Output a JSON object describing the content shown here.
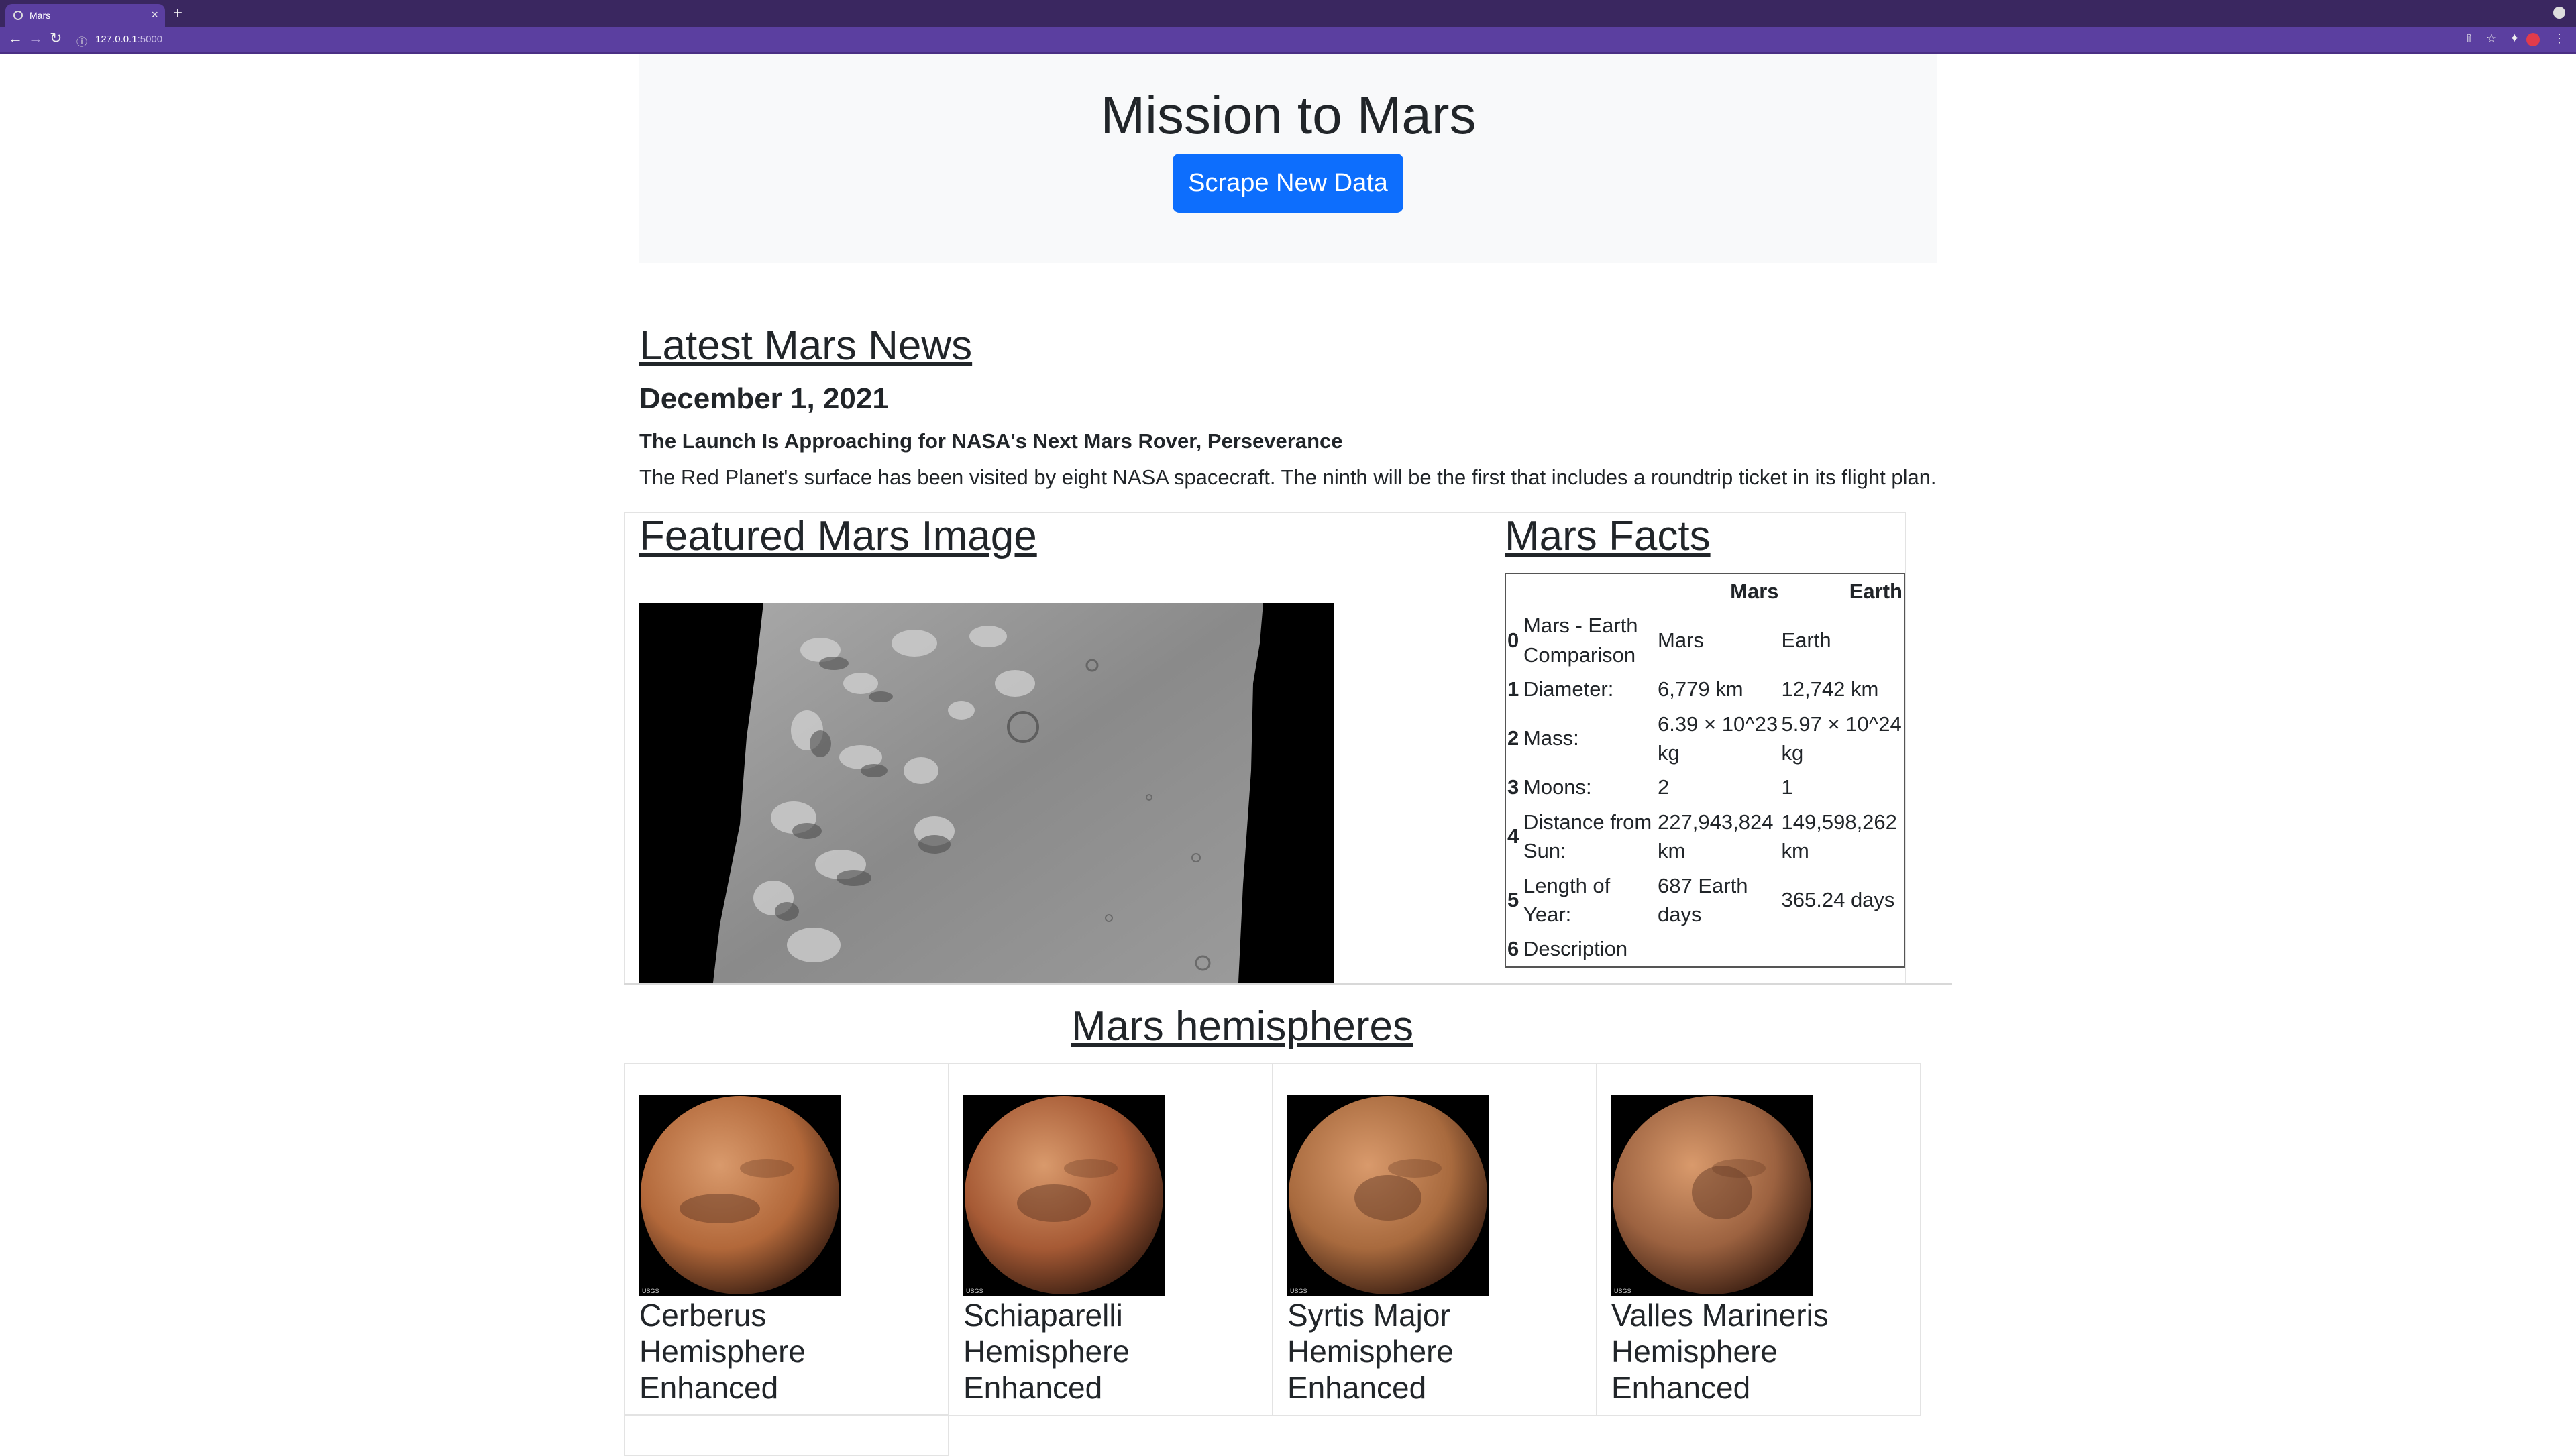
{
  "browser": {
    "tab_title": "Mars",
    "url_host": "127.0.0.1",
    "url_port": ":5000"
  },
  "header": {
    "title": "Mission to Mars",
    "scrape_button": "Scrape New Data"
  },
  "news": {
    "section_title": "Latest Mars News",
    "date": "December 1, 2021",
    "headline": "The Launch Is Approaching for NASA's Next Mars Rover, Perseverance",
    "body": "The Red Planet's surface has been visited by eight NASA spacecraft. The ninth will be the first that includes a roundtrip ticket in its flight plan."
  },
  "featured": {
    "section_title": "Featured Mars Image"
  },
  "facts": {
    "section_title": "Mars Facts",
    "col_mars": "Mars",
    "col_earth": "Earth",
    "rows": [
      {
        "idx": "0",
        "label": "Mars - Earth Comparison",
        "mars": "Mars",
        "earth": "Earth"
      },
      {
        "idx": "1",
        "label": "Diameter:",
        "mars": "6,779 km",
        "earth": "12,742 km"
      },
      {
        "idx": "2",
        "label": "Mass:",
        "mars": "6.39 × 10^23 kg",
        "earth": "5.97 × 10^24 kg"
      },
      {
        "idx": "3",
        "label": "Moons:",
        "mars": "2",
        "earth": "1"
      },
      {
        "idx": "4",
        "label": "Distance from Sun:",
        "mars": "227,943,824 km",
        "earth": "149,598,262 km"
      },
      {
        "idx": "5",
        "label": "Length of Year:",
        "mars": "687 Earth days",
        "earth": "365.24 days"
      },
      {
        "idx": "6",
        "label": "Description",
        "mars": "",
        "earth": ""
      }
    ]
  },
  "hemispheres": {
    "section_title": "Mars hemispheres",
    "items": [
      {
        "line1": "Cerberus",
        "line2": "Hemisphere",
        "line3": "Enhanced",
        "tone": "#b2683a"
      },
      {
        "line1": "Schiaparelli",
        "line2": "Hemisphere",
        "line3": "Enhanced",
        "tone": "#a65a35"
      },
      {
        "line1": "Syrtis Major",
        "line2": "Hemisphere",
        "line3": "Enhanced",
        "tone": "#a86a3e"
      },
      {
        "line1": "Valles Marineris",
        "line2": "Hemisphere",
        "line3": "Enhanced",
        "tone": "#9c6240"
      }
    ],
    "usgs_mark": "USGS"
  }
}
